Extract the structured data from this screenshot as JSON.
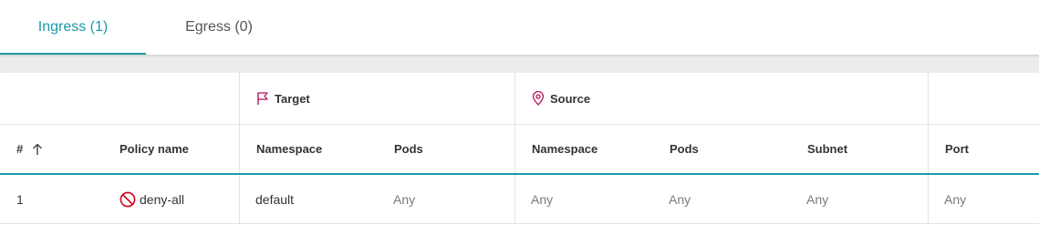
{
  "tabs": [
    {
      "label": "Ingress (1)",
      "active": true
    },
    {
      "label": "Egress (0)",
      "active": false
    }
  ],
  "table": {
    "groups": {
      "target": {
        "label": "Target",
        "icon": "flag-icon"
      },
      "source": {
        "label": "Source",
        "icon": "map-pin-icon"
      }
    },
    "columns": {
      "index": "#",
      "policy_name": "Policy name",
      "target_namespace": "Namespace",
      "target_pods": "Pods",
      "source_namespace": "Namespace",
      "source_pods": "Pods",
      "source_subnet": "Subnet",
      "port": "Port"
    },
    "sort": {
      "column": "#",
      "direction": "ascending",
      "icon": "arrow-up-icon"
    },
    "rows": [
      {
        "index": "1",
        "policy_name": "deny-all",
        "policy_icon": "deny-icon",
        "target_namespace": "default",
        "target_pods": "Any",
        "source_namespace": "Any",
        "source_pods": "Any",
        "source_subnet": "Any",
        "port": "Any"
      }
    ]
  },
  "colors": {
    "accent": "#1b9aaa",
    "icon_magenta": "#b4145a",
    "deny_red": "#d0021b"
  }
}
